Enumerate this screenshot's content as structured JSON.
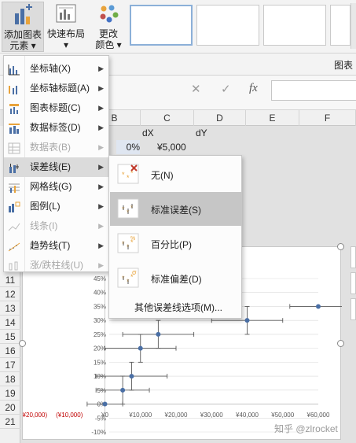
{
  "ribbon": {
    "add_element": {
      "line1": "添加图表",
      "line2": "元素 ▾"
    },
    "quick_layout": {
      "line1": "快速布局",
      "line2": "▾"
    },
    "change_colors": {
      "line1": "更改",
      "line2": "颜色 ▾"
    },
    "group_label": "图表"
  },
  "formula_bar": {
    "cancel": "✕",
    "confirm": "✓",
    "fx": "fx"
  },
  "columns": [
    "B",
    "C",
    "D",
    "E",
    "F"
  ],
  "rows": [
    "11",
    "12",
    "13",
    "14",
    "15",
    "16",
    "17",
    "18",
    "19",
    "20",
    "21"
  ],
  "cells": {
    "c_header": "dX",
    "d_header": "dY",
    "b2": "0%",
    "c2": "¥5,000"
  },
  "chart_element_menu": {
    "items": [
      {
        "label": "坐标轴(X)",
        "icon": "axes-icon",
        "enabled": true
      },
      {
        "label": "坐标轴标题(A)",
        "icon": "axis-title-icon",
        "enabled": true
      },
      {
        "label": "图表标题(C)",
        "icon": "chart-title-icon",
        "enabled": true
      },
      {
        "label": "数据标签(D)",
        "icon": "data-labels-icon",
        "enabled": true
      },
      {
        "label": "数据表(B)",
        "icon": "data-table-icon",
        "enabled": false
      },
      {
        "label": "误差线(E)",
        "icon": "error-bars-icon",
        "enabled": true,
        "highlighted": true
      },
      {
        "label": "网格线(G)",
        "icon": "gridlines-icon",
        "enabled": true
      },
      {
        "label": "图例(L)",
        "icon": "legend-icon",
        "enabled": true
      },
      {
        "label": "线条(I)",
        "icon": "lines-icon",
        "enabled": false
      },
      {
        "label": "趋势线(T)",
        "icon": "trendline-icon",
        "enabled": true
      },
      {
        "label": "涨/跌柱线(U)",
        "icon": "updown-bars-icon",
        "enabled": false
      }
    ]
  },
  "error_bars_menu": {
    "items": [
      {
        "label": "无(N)",
        "icon": "error-bars-none-icon"
      },
      {
        "label": "标准误差(S)",
        "icon": "error-bars-standard-error-icon",
        "highlighted": true
      },
      {
        "label": "百分比(P)",
        "icon": "error-bars-percentage-icon"
      },
      {
        "label": "标准偏差(D)",
        "icon": "error-bars-standard-deviation-icon"
      }
    ],
    "more_options": "其他误差线选项(M)..."
  },
  "chart_data": {
    "type": "scatter",
    "x_tick_labels": [
      "(¥20,000)",
      "(¥10,000)",
      "¥0",
      "¥10,000",
      "¥20,000",
      "¥30,000",
      "¥40,000",
      "¥50,000",
      "¥60,000"
    ],
    "y_tick_labels": [
      "45%",
      "40%",
      "35%",
      "30%",
      "25%",
      "20%",
      "15%",
      "10%",
      "5%",
      "0%",
      "-5%",
      "-10%"
    ],
    "xlim": [
      -20000,
      60000
    ],
    "ylim": [
      -0.1,
      0.45
    ],
    "points": [
      {
        "x": 0,
        "y": 0.0,
        "x_err": 5000,
        "y_err": 0.0
      },
      {
        "x": 5000,
        "y": 0.05,
        "x_err": 7500,
        "y_err": 0.05
      },
      {
        "x": 7500,
        "y": 0.1,
        "x_err": 10000,
        "y_err": 0.05
      },
      {
        "x": 10000,
        "y": 0.2,
        "x_err": 10000,
        "y_err": 0.05
      },
      {
        "x": 15000,
        "y": 0.25,
        "x_err": 10000,
        "y_err": 0.05
      },
      {
        "x": 40000,
        "y": 0.3,
        "x_err": 10000,
        "y_err": 0.05
      },
      {
        "x": 60000,
        "y": 0.35,
        "x_err": 8000,
        "y_err": 0.0
      }
    ],
    "colors": {
      "marker": "#4a6fa5",
      "error_bar": "#595959",
      "negative_label": "#c00000",
      "gridline": "#d9d9d9"
    },
    "grid": true
  },
  "watermark": "知乎 @zlrocket"
}
